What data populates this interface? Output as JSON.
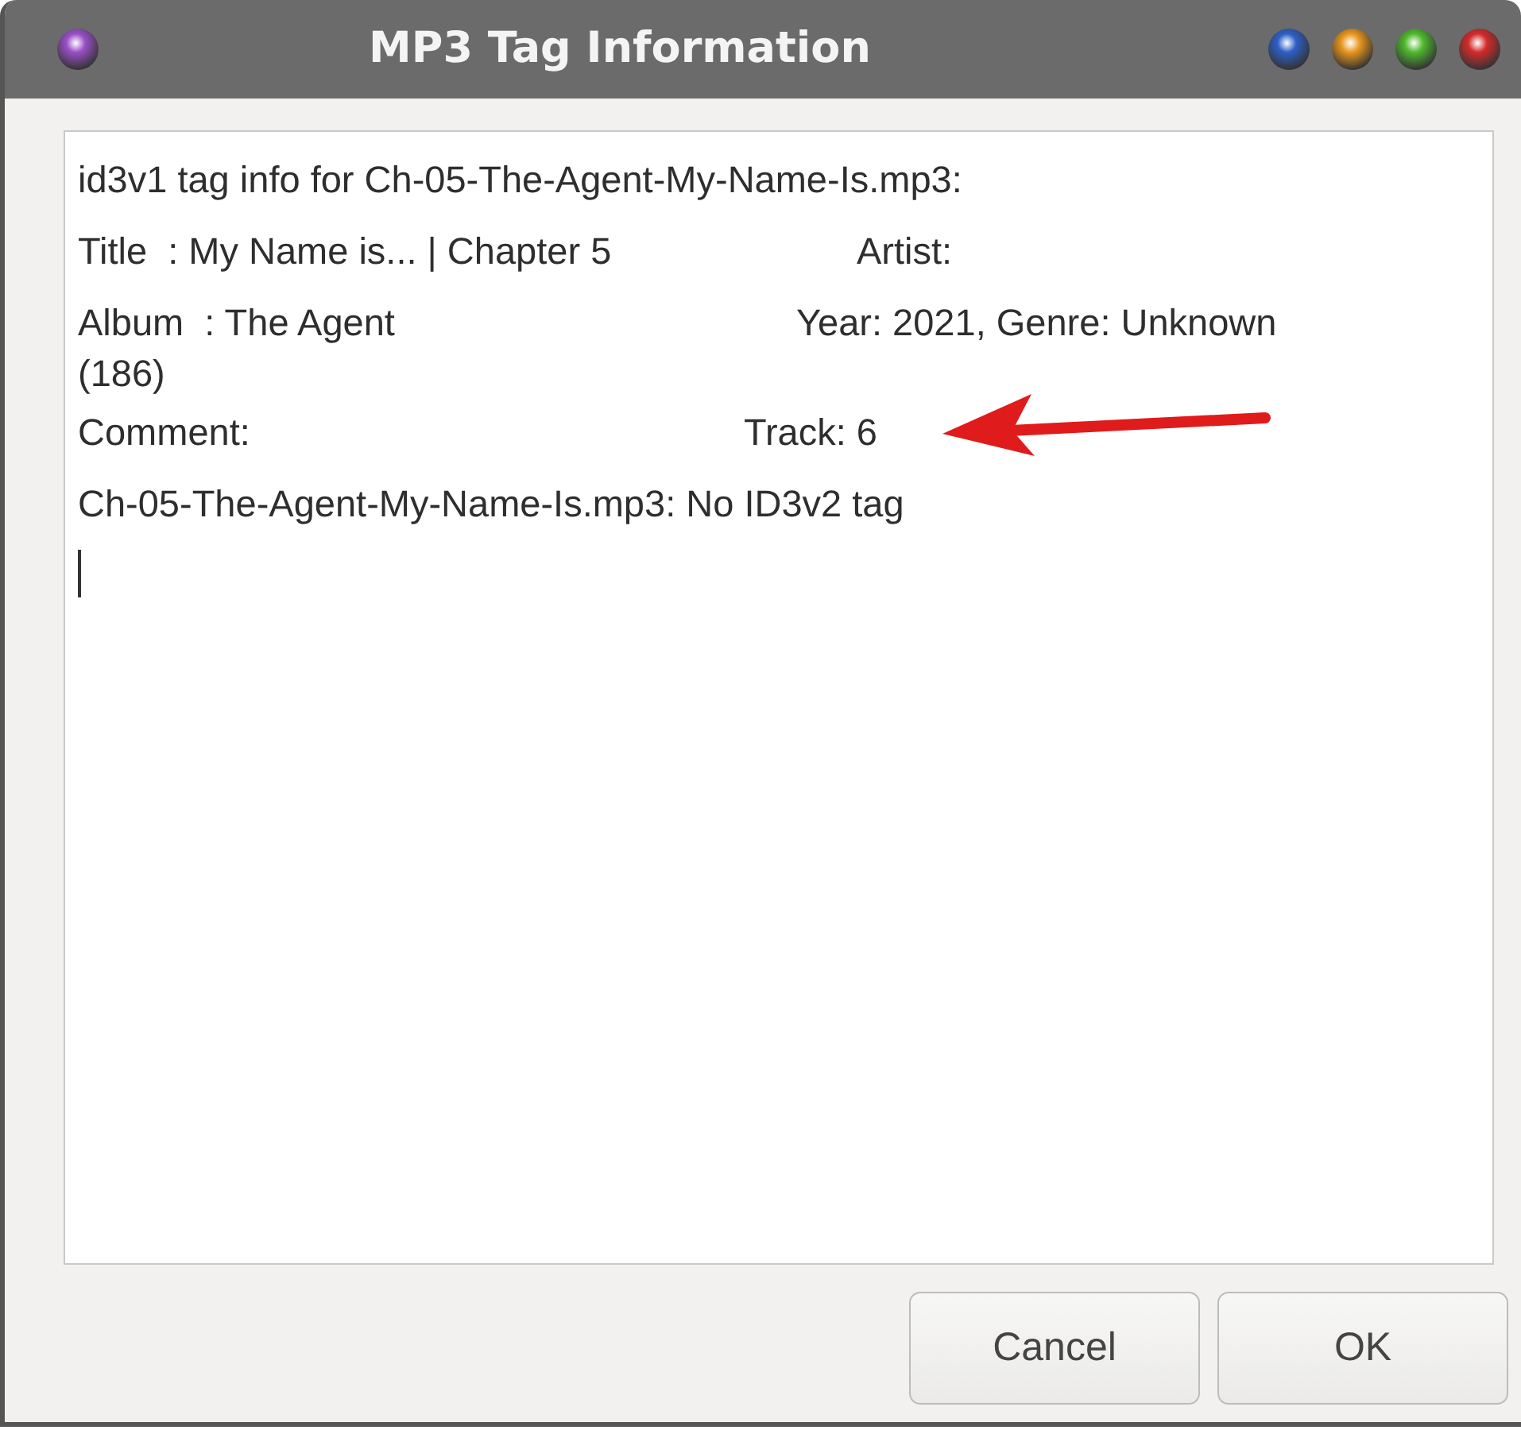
{
  "window": {
    "title": "MP3 Tag Information"
  },
  "text_lines": [
    {
      "parts": [
        "id3v1 tag info for Ch-05-The-Agent-My-Name-Is.mp3:"
      ]
    },
    {
      "parts": [
        "Title  : My Name is... | Chapter 5",
        "Artist:"
      ]
    },
    {
      "parts": [
        "Album  : The Agent",
        "Year: 2021, Genre: Unknown"
      ]
    },
    {
      "parts": [
        "(186)"
      ]
    },
    {
      "parts": [
        "Comment:",
        "Track: 6"
      ]
    },
    {
      "parts": [
        "Ch-05-The-Agent-My-Name-Is.mp3: No ID3v2 tag"
      ]
    }
  ],
  "buttons": [
    "Cancel",
    "OK"
  ]
}
